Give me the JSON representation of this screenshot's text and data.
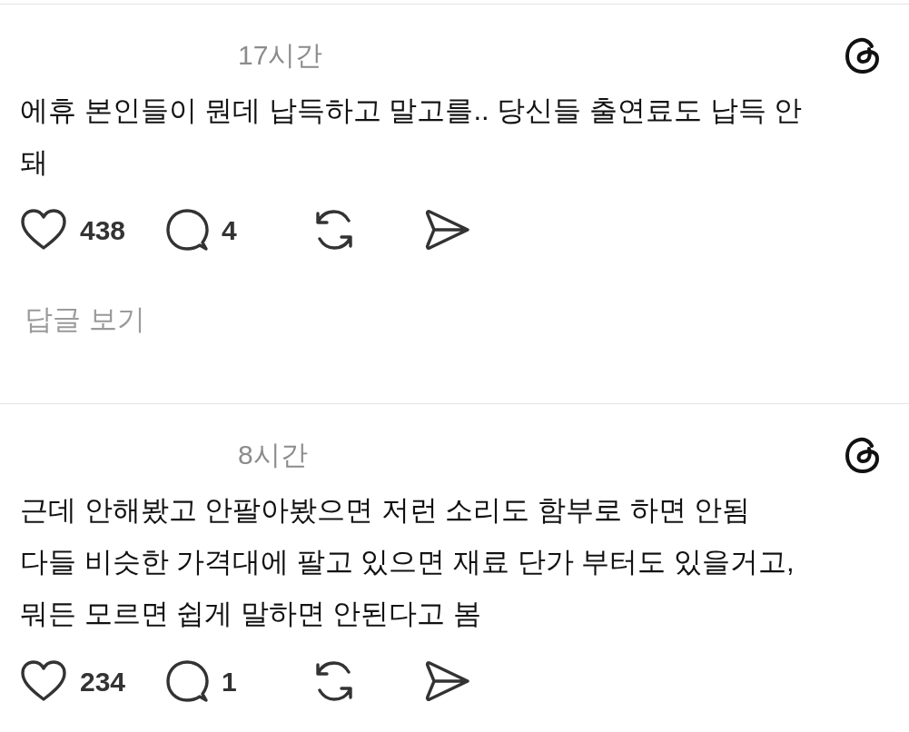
{
  "posts": [
    {
      "time": "17시간",
      "lines": [
        "에휴 본인들이 뭔데 납득하고 말고를.. 당신들 출연료도 납득 안",
        "돼"
      ],
      "likes": "438",
      "replies": "4",
      "view_replies": "답글 보기"
    },
    {
      "time": "8시간",
      "lines": [
        "근데 안해봤고 안팔아봤으면 저런 소리도 함부로 하면 안됨",
        "다들 비슷한 가격대에 팔고 있으면 재료 단가 부터도 있을거고,",
        "뭐든 모르면 쉽게 말하면 안된다고 봄"
      ],
      "likes": "234",
      "replies": "1"
    }
  ]
}
